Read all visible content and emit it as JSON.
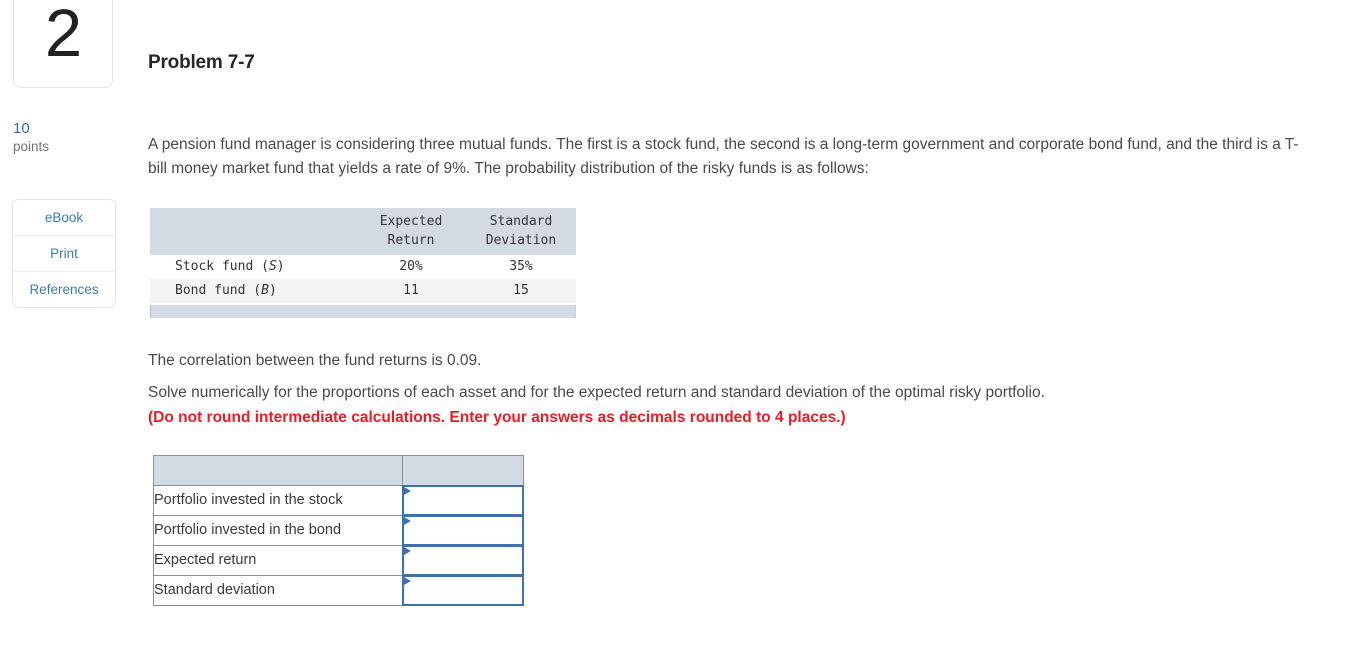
{
  "sidebar": {
    "question_number": "2",
    "points_value": "10",
    "points_label": "points",
    "tools": [
      {
        "label": "eBook"
      },
      {
        "label": "Print"
      },
      {
        "label": "References"
      }
    ]
  },
  "main": {
    "title": "Problem 7-7",
    "intro": "A pension fund manager is considering three mutual funds. The first is a stock fund, the second is a long-term government and corporate bond fund, and the third is a T-bill money market fund that yields a rate of 9%. The probability distribution of the risky funds is as follows:",
    "correlation": "The correlation between the fund returns is 0.09.",
    "solve": "Solve numerically for the proportions of each asset and for the expected return and standard deviation of the optimal risky portfolio.",
    "solve_note": "(Do not round intermediate calculations. Enter your answers as decimals rounded to 4 places.)"
  },
  "fund_table": {
    "headers": [
      "",
      "Expected Return",
      "Standard Deviation"
    ],
    "header_lines": [
      [
        "",
        ""
      ],
      [
        "Expected",
        "Return"
      ],
      [
        "Standard",
        "Deviation"
      ]
    ],
    "rows": [
      {
        "label": "Stock fund",
        "symbol": "S",
        "expected_return": "20%",
        "standard_deviation": "35%"
      },
      {
        "label": "Bond fund",
        "symbol": "B",
        "expected_return": "11",
        "standard_deviation": "15"
      }
    ]
  },
  "answer_table": {
    "header_left": "",
    "header_right": "",
    "rows": [
      {
        "label": "Portfolio invested in the stock",
        "value": "",
        "placeholder": ""
      },
      {
        "label": "Portfolio invested in the bond",
        "value": "",
        "placeholder": ""
      },
      {
        "label": "Expected return",
        "value": "",
        "placeholder": ""
      },
      {
        "label": "Standard deviation",
        "value": "",
        "placeholder": ""
      }
    ]
  },
  "colors": {
    "table_header_bg": "#d4dae4",
    "input_border": "#3d72ad",
    "note_red": "#ec1c24",
    "link_blue": "#3f7cb6",
    "points_blue": "#2f6fad"
  }
}
